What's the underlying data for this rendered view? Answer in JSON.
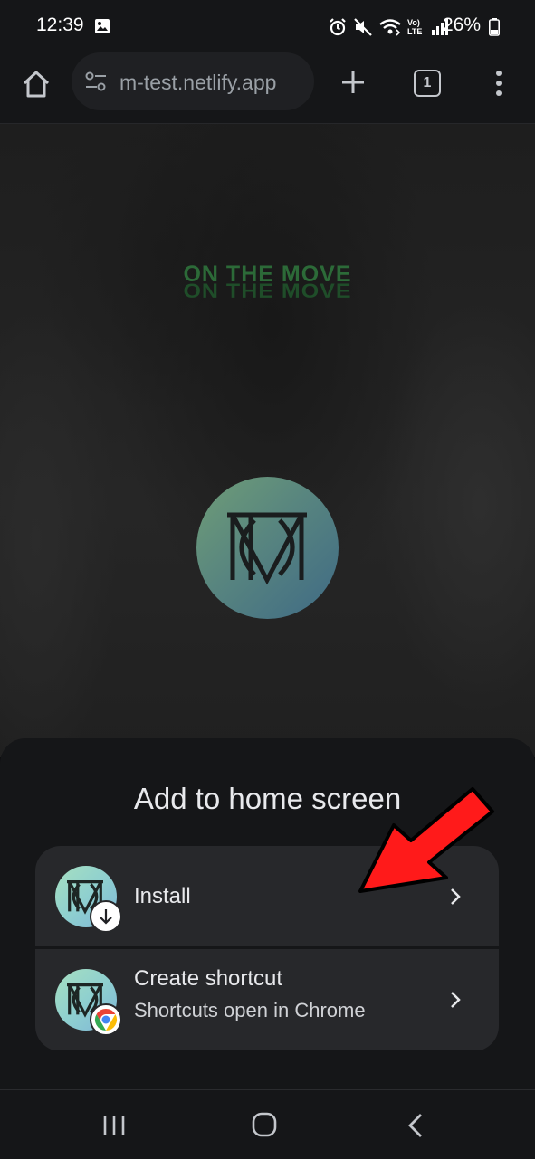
{
  "status_bar": {
    "time": "12:39",
    "network_label": "Vo) LTE",
    "battery": "26%"
  },
  "browser": {
    "url": "m-test.netlify.app",
    "tab_count": "1"
  },
  "page": {
    "title": "ON THE MOVE",
    "logo_icon": "otm-monogram-logo"
  },
  "sheet": {
    "title": "Add to home screen",
    "options": [
      {
        "label": "Install",
        "icon": "app-icon-download-badge"
      },
      {
        "label": "Create shortcut",
        "sublabel": "Shortcuts open in Chrome",
        "icon": "app-icon-chrome-badge"
      }
    ]
  },
  "colors": {
    "accent_green": "#2c6a38",
    "annotation_red": "#ff1a1a",
    "sheet_bg": "#151618",
    "option_bg": "#27282b"
  }
}
